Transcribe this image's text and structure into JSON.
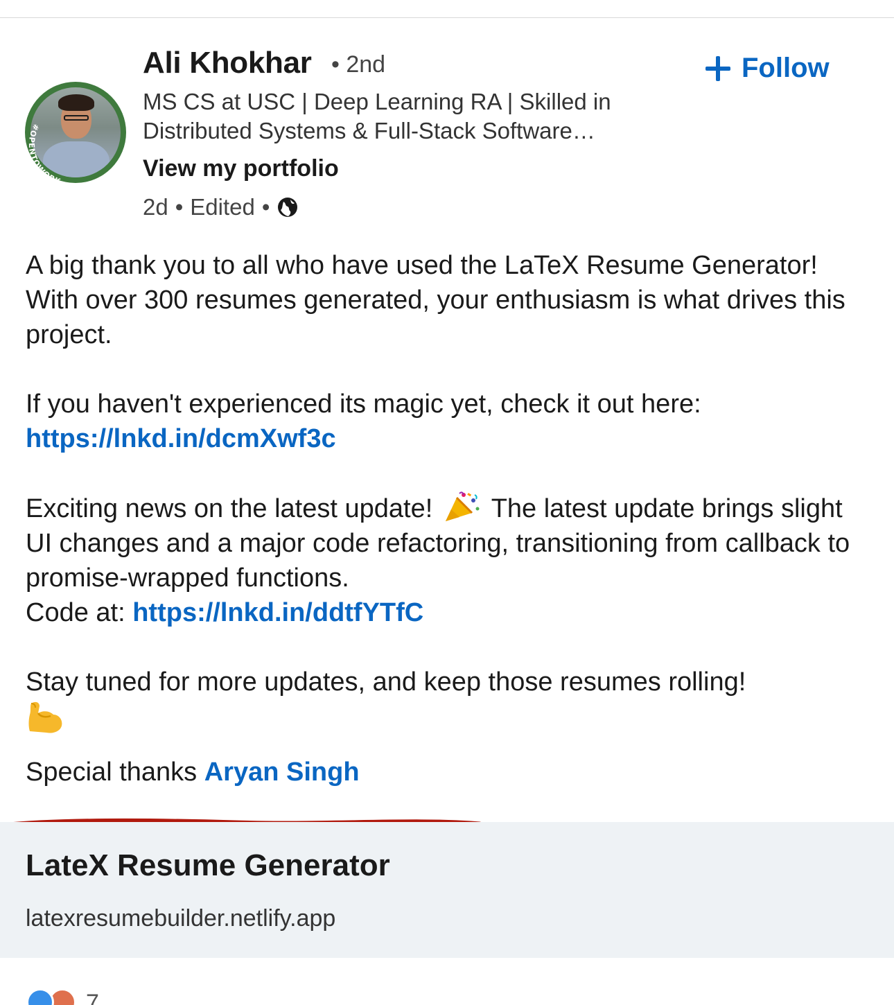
{
  "author": {
    "name": "Ali Khokhar",
    "degree": "• 2nd",
    "headline": "MS CS at USC | Deep Learning RA | Skilled in Distributed Systems & Full-Stack Software…",
    "portfolio_link": "View my portfolio",
    "avatar_badge": "#OPENTOWORK",
    "time": "2d",
    "edited": "Edited",
    "visibility_icon": "globe-icon"
  },
  "follow_button": {
    "label": "Follow",
    "icon": "plus-icon"
  },
  "post": {
    "p1": "A big thank you to all who have used the LaTeX Resume Generator! With over 300 resumes generated, your enthusiasm is what drives this project.",
    "p2_text": "If you haven't experienced its magic yet, check it out here:",
    "p2_link": "https://lnkd.in/dcmXwf3c",
    "p3_text_a": "Exciting news on the latest update!",
    "p3_emoji": "party-popper",
    "p3_text_b": "The latest update brings slight UI changes and a major code refactoring, transitioning from callback to promise-wrapped functions.",
    "p3_code_prefix": "Code at:",
    "p3_link": "https://lnkd.in/ddtfYTfC",
    "p4_text": "Stay tuned for more updates, and keep those resumes rolling!",
    "p4_emoji": "flexed-biceps",
    "p5_text": "Special thanks",
    "p5_mention": "Aryan Singh"
  },
  "annotation_color": "#b11a0e",
  "link_preview": {
    "title": "LateX Resume Generator",
    "domain": "latexresumebuilder.netlify.app"
  },
  "reactions": {
    "count": "7",
    "icons": [
      "like-reaction-icon",
      "love-reaction-icon"
    ]
  },
  "colors": {
    "link": "#0a66c2",
    "preview_bg": "#eef2f5"
  }
}
